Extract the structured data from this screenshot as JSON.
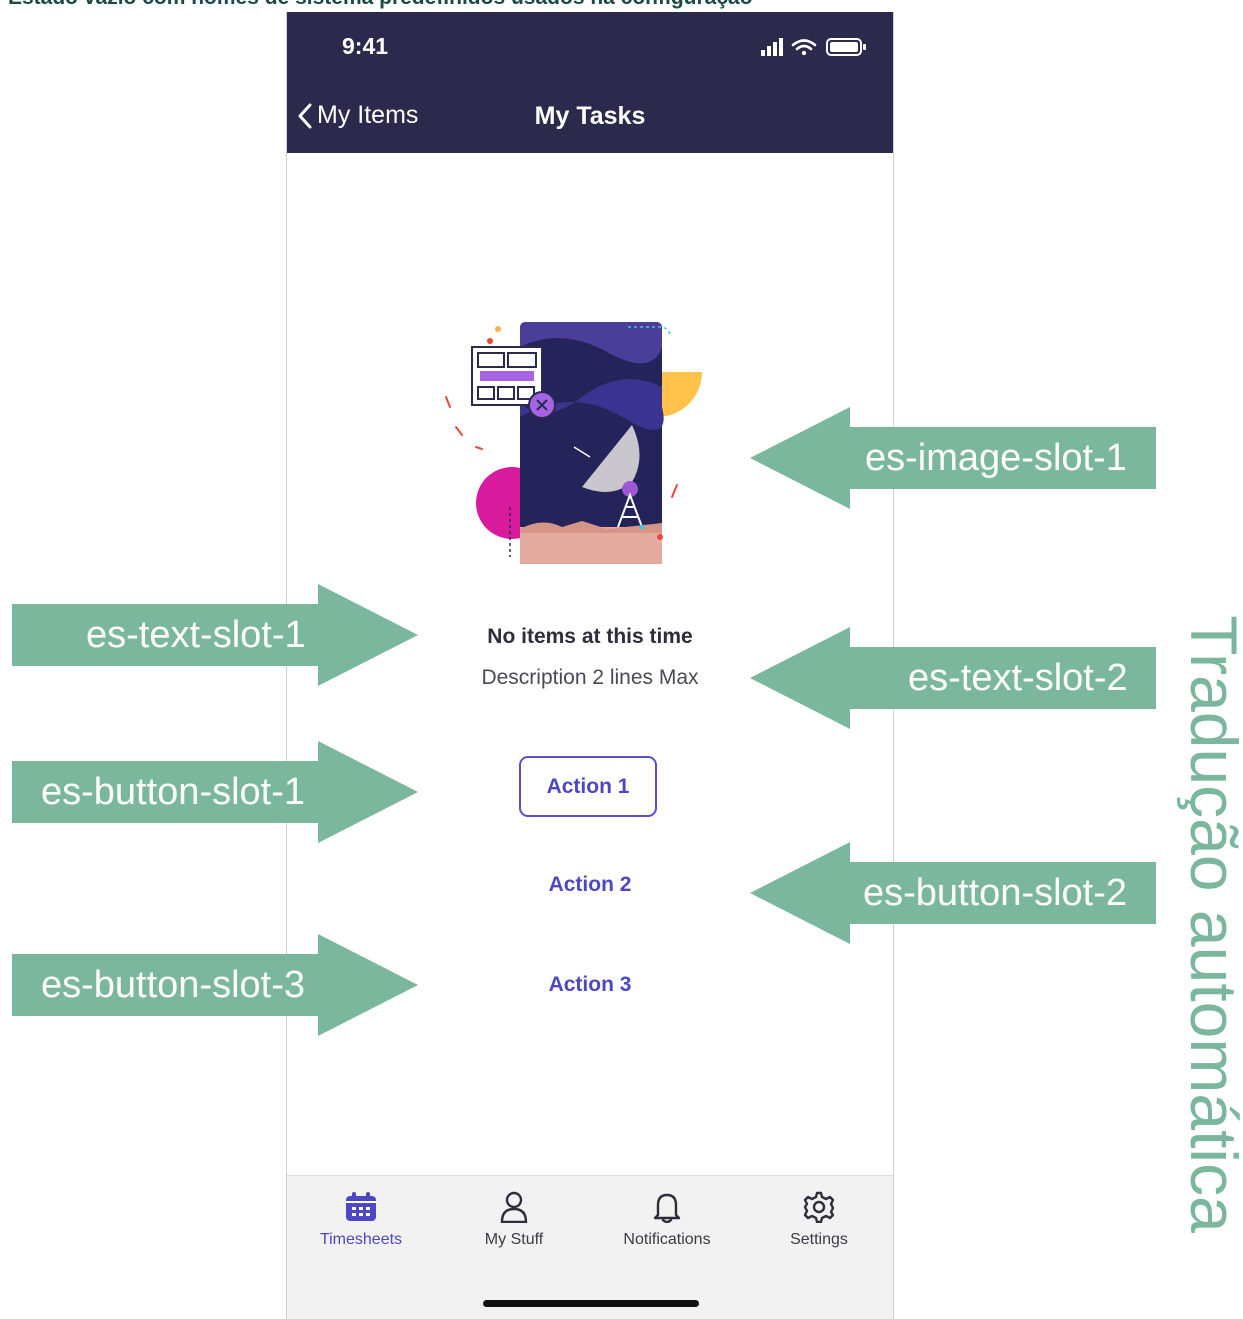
{
  "caption": "Estado vazio com nomes de sistema predefinidos usados na configuração",
  "status_bar": {
    "time": "9:41"
  },
  "nav": {
    "back_label": "My Items",
    "title": "My Tasks"
  },
  "empty_state": {
    "title": "No items at this time",
    "description": "Description 2 lines Max",
    "buttons": [
      "Action 1",
      "Action 2",
      "Action 3"
    ]
  },
  "tabs": [
    {
      "label": "Timesheets",
      "icon": "calendar-icon",
      "active": true
    },
    {
      "label": "My Stuff",
      "icon": "person-icon",
      "active": false
    },
    {
      "label": "Notifications",
      "icon": "bell-icon",
      "active": false
    },
    {
      "label": "Settings",
      "icon": "gear-icon",
      "active": false
    }
  ],
  "annotations": {
    "image_slot": "es-image-slot-1",
    "text_slot_1": "es-text-slot-1",
    "text_slot_2": "es-text-slot-2",
    "button_slot_1": "es-button-slot-1",
    "button_slot_2": "es-button-slot-2",
    "button_slot_3": "es-button-slot-3"
  },
  "side_note": "Tradução automática",
  "colors": {
    "header_bg": "#2b2a4c",
    "accent": "#4d47c4",
    "annotation_arrow": "#7bb79c",
    "caption_text": "#1b4a45"
  }
}
